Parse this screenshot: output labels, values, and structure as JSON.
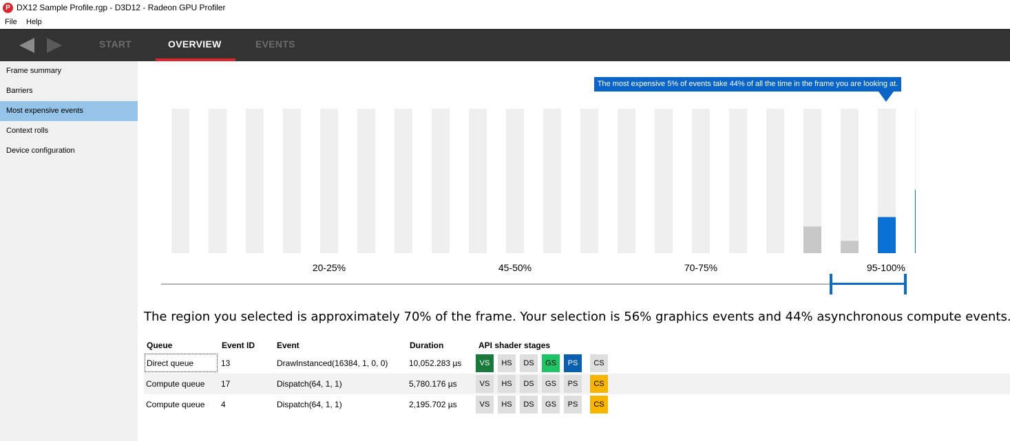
{
  "window": {
    "app_icon_letter": "P",
    "title": "DX12 Sample Profile.rgp - D3D12 - Radeon GPU Profiler"
  },
  "menu": {
    "file": "File",
    "help": "Help"
  },
  "nav": {
    "tabs": [
      "START",
      "OVERVIEW",
      "EVENTS"
    ],
    "active_tab": "OVERVIEW"
  },
  "sidebar": {
    "items": [
      {
        "label": "Frame summary"
      },
      {
        "label": "Barriers"
      },
      {
        "label": "Most expensive events"
      },
      {
        "label": "Context rolls"
      },
      {
        "label": "Device configuration"
      }
    ],
    "selected": "Most expensive events"
  },
  "tooltip": "The most expensive 5% of events take 44% of all the time in the frame you are looking at.",
  "chart_data": {
    "type": "bar",
    "values": [
      0,
      0,
      0,
      0,
      0,
      0,
      0,
      0,
      0,
      0,
      0,
      0,
      0,
      0,
      0,
      0,
      0,
      18.5,
      8.5,
      25,
      44
    ],
    "max_value": 100,
    "selected_range": [
      19,
      20
    ],
    "x_tick_labels": [
      "20-25%",
      "45-50%",
      "70-75%",
      "95-100%"
    ],
    "colors": {
      "background": "#efefef",
      "unselected": "#c8c8c8",
      "selected": "#0a72d6"
    }
  },
  "summary": "The region you selected is approximately 70% of the frame. Your selection is 56% graphics events and 44% asynchronous compute events.",
  "table": {
    "headers": {
      "queue": "Queue",
      "event_id": "Event ID",
      "event": "Event",
      "duration": "Duration",
      "stages": "API shader stages"
    },
    "rows": [
      {
        "queue": "Direct queue",
        "event_id": "13",
        "event": "DrawInstanced(16384, 1, 0, 0)",
        "duration": "10,052.283 µs",
        "stages": [
          {
            "label": "VS",
            "state": "vs"
          },
          {
            "label": "HS",
            "state": "off"
          },
          {
            "label": "DS",
            "state": "off"
          },
          {
            "label": "GS",
            "state": "gs"
          },
          {
            "label": "PS",
            "state": "ps"
          },
          {
            "label": "CS",
            "state": "off"
          }
        ]
      },
      {
        "queue": "Compute queue",
        "event_id": "17",
        "event": "Dispatch(64, 1, 1)",
        "duration": "5,780.176 µs",
        "stages": [
          {
            "label": "VS",
            "state": "off"
          },
          {
            "label": "HS",
            "state": "off"
          },
          {
            "label": "DS",
            "state": "off"
          },
          {
            "label": "GS",
            "state": "off"
          },
          {
            "label": "PS",
            "state": "off"
          },
          {
            "label": "CS",
            "state": "cs"
          }
        ]
      },
      {
        "queue": "Compute queue",
        "event_id": "4",
        "event": "Dispatch(64, 1, 1)",
        "duration": "2,195.702 µs",
        "stages": [
          {
            "label": "VS",
            "state": "off"
          },
          {
            "label": "HS",
            "state": "off"
          },
          {
            "label": "DS",
            "state": "off"
          },
          {
            "label": "GS",
            "state": "off"
          },
          {
            "label": "PS",
            "state": "off"
          },
          {
            "label": "CS",
            "state": "cs"
          }
        ]
      }
    ],
    "stage_colors": {
      "off": {
        "bg": "#dedede",
        "fg": "#000000"
      },
      "vs": {
        "bg": "#1a7a3c",
        "fg": "#ffffff"
      },
      "gs": {
        "bg": "#1ec466",
        "fg": "#000000"
      },
      "ps": {
        "bg": "#0b5fb0",
        "fg": "#ffffff"
      },
      "cs": {
        "bg": "#f7b500",
        "fg": "#000000"
      }
    }
  }
}
